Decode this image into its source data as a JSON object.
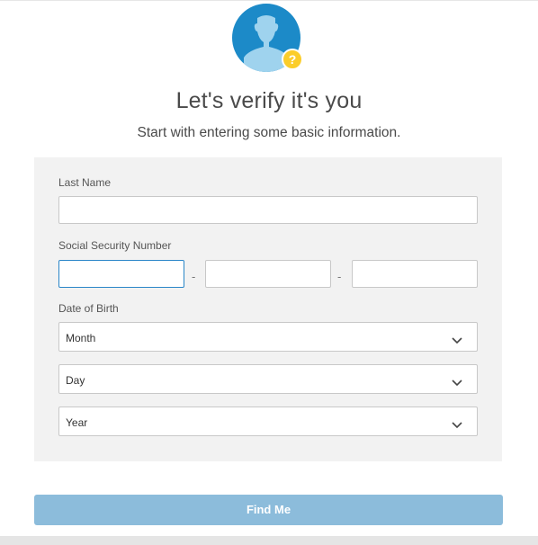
{
  "header": {
    "avatar_icon": "user-silhouette-icon",
    "badge_icon": "question-mark-icon",
    "badge_text": "?",
    "title": "Let's verify it's you",
    "subtitle": "Start with entering some basic information."
  },
  "form": {
    "last_name": {
      "label": "Last Name",
      "value": "",
      "placeholder": ""
    },
    "ssn": {
      "label": "Social Security Number",
      "part1": "",
      "part2": "",
      "part3": "",
      "separator": "-"
    },
    "dob": {
      "label": "Date of Birth",
      "month": "Month",
      "day": "Day",
      "year": "Year",
      "chevron_icon": "chevron-down-icon"
    }
  },
  "actions": {
    "submit_label": "Find Me"
  },
  "colors": {
    "avatar_bg": "#1c8ac8",
    "avatar_figure": "#9fd3ee",
    "badge": "#fbcd2a",
    "panel_bg": "#f2f2f2",
    "focus_border": "#2a86c8",
    "button_bg": "#8cbcdb"
  }
}
